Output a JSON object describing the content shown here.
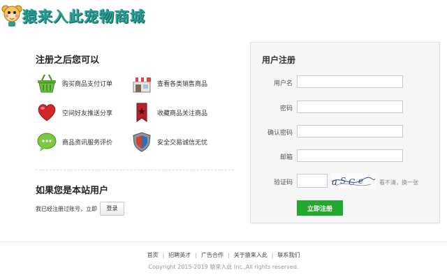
{
  "site": {
    "title": "猿来入此宠物商城",
    "logo_icon": "cartoon-monkey-icon"
  },
  "benefits": {
    "title": "注册之后您可以",
    "items": [
      {
        "label": "购买商品支付订单",
        "icon": "shopping-basket-icon"
      },
      {
        "label": "查看各类销售商品",
        "icon": "shop-storefront-icon"
      },
      {
        "label": "空间好友推送分享",
        "icon": "heart-icon"
      },
      {
        "label": "收藏商品关注商品",
        "icon": "bookmark-tag-icon"
      },
      {
        "label": "商品资讯服务评价",
        "icon": "chat-bubble-icon"
      },
      {
        "label": "安全交易诚信无忧",
        "icon": "shield-icon"
      }
    ]
  },
  "member": {
    "title": "如果您是本站用户",
    "text": "我已经注册过账号，立即",
    "login_label": "登录"
  },
  "register": {
    "title": "用户注册",
    "username_label": "用户名",
    "password_label": "密码",
    "confirm_label": "确认密码",
    "email_label": "邮箱",
    "captcha_label": "验证码",
    "refresh_label": "看不清，换一张",
    "submit_label": "立即注册"
  },
  "footer": {
    "links": [
      "首页",
      "招聘英才",
      "广告合作",
      "关于猿来入此",
      "联系我们"
    ],
    "copyright": "Copyright 2015-2019 猿来入此 Inc.,All rights reserved."
  },
  "colors": {
    "brand": "#2a9a92",
    "submit": "#23a92f"
  }
}
